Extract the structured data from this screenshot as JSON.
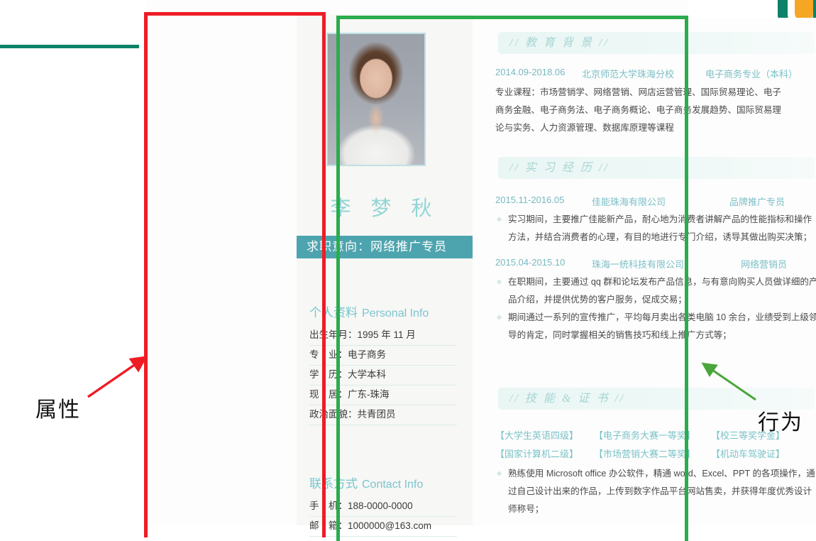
{
  "slide": {
    "logo_alt": "company-logo",
    "accent_rule_color": "#0d8268"
  },
  "annotations": {
    "left_label": "属性",
    "right_label": "行为",
    "left_arrow": "red-arrow-up-right",
    "right_arrow": "green-arrow-up-left",
    "red_box_color": "#ee1c25",
    "green_box_color": "#2bac4d"
  },
  "resume": {
    "left": {
      "photo_alt": "applicant-portrait",
      "name": "李 梦 秋",
      "objective": "求职意向：网络推广专员",
      "personal": {
        "title_cn": "个人资料",
        "title_en": "Personal Info",
        "rows": [
          {
            "key": "出生年月",
            "value": "1995 年 11 月",
            "spaced": false
          },
          {
            "key": "专　业",
            "value": "电子商务",
            "spaced": true
          },
          {
            "key": "学　历",
            "value": "大学本科",
            "spaced": true
          },
          {
            "key": "现　居",
            "value": "广东-珠海",
            "spaced": true
          },
          {
            "key": "政治面貌",
            "value": "共青团员",
            "spaced": false
          }
        ]
      },
      "contact": {
        "title_cn": "联系方式",
        "title_en": "Contact Info",
        "rows": [
          {
            "key": "手　机",
            "value": "188-0000-0000",
            "spaced": true
          },
          {
            "key": "邮　箱",
            "value": "1000000@163.com",
            "spaced": true
          }
        ]
      }
    },
    "right": {
      "sections": [
        {
          "heading": "//  教 育 背 景  //"
        },
        {
          "heading": "//  实 习 经 历  //"
        },
        {
          "heading": "//  技 能 & 证 书  //"
        }
      ],
      "education": {
        "date": "2014.09-2018.06",
        "school": "北京师范大学珠海分校",
        "major": "电子商务专业（本科）",
        "courses_line1": "专业课程：市场营销学、网络营销、网店运营管理、国际贸易理论、电子",
        "courses_line2": "商务金融、电子商务法、电子商务概论、电子商务发展趋势、国际贸易理",
        "courses_line3": "论与实务、人力资源管理、数据库原理等课程"
      },
      "internships": [
        {
          "date": "2015.11-2016.05",
          "company": "佳能珠海有限公司",
          "role": "品牌推广专员",
          "bullets": [
            "实习期间，主要推广佳能新产品，耐心地为消费者讲解产品的性能指标和操作方法，并结合消费者的心理，有目的地进行专门介绍，诱导其做出购买决策；"
          ]
        },
        {
          "date": "2015.04-2015.10",
          "company": "珠海一统科技有限公司",
          "role": "网络营销员",
          "bullets": [
            "在职期间，主要通过 qq 群和论坛发布产品信息，与有意向购买人员做详细的产品介绍，并提供优势的客户服务，促成交易；",
            "期间通过一系列的宣传推广，平均每月卖出各类电脑 10 余台，业绩受到上级领导的肯定，同时掌握相关的销售技巧和线上推广方式等；"
          ]
        }
      ],
      "skills": {
        "tags_row1": [
          "【大学生英语四级】",
          "【电子商务大赛一等奖】",
          "【校三等奖学金】"
        ],
        "tags_row2": [
          "【国家计算机二级】",
          "【市场营销大赛二等奖】",
          "【机动车驾驶证】"
        ],
        "bullets": [
          "熟练使用 Microsoft office 办公软件，精通 word、Excel、PPT 的各项操作，通过自己设计出来的作品，上传到数字作品平台网站售卖，并获得年度优秀设计师称号；"
        ]
      }
    }
  }
}
